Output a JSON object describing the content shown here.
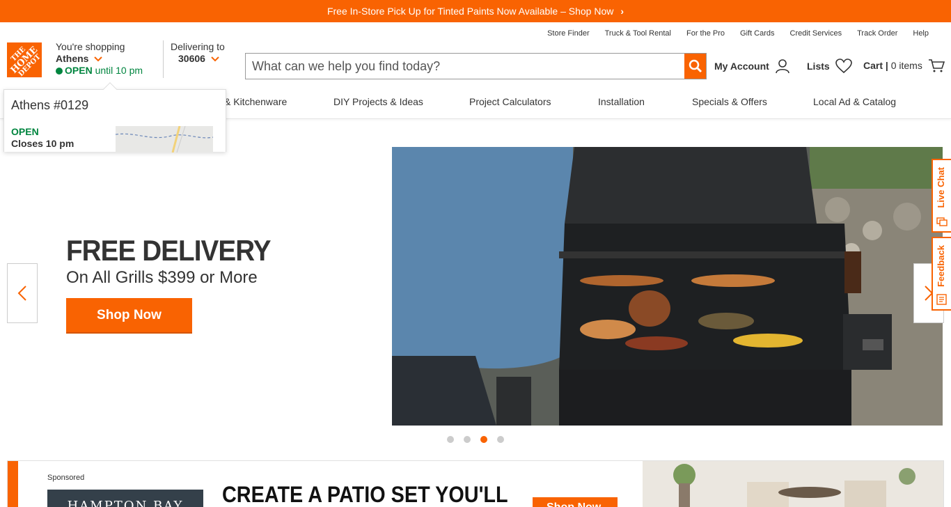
{
  "promo": {
    "text": "Free In-Store Pick Up for Tinted Paints Now Available – Shop Now",
    "chevron": "›"
  },
  "utility_links": [
    "Store Finder",
    "Truck & Tool Rental",
    "For the Pro",
    "Gift Cards",
    "Credit Services",
    "Track Order",
    "Help"
  ],
  "logo": {
    "line1": "THE",
    "line2": "HOME",
    "line3": "DEPOT"
  },
  "store": {
    "label": "You're shopping",
    "city": "Athens",
    "open_label": "OPEN",
    "hours": "until 10 pm"
  },
  "delivery": {
    "label": "Delivering to",
    "zip": "30606"
  },
  "search": {
    "placeholder": "What can we help you find today?"
  },
  "header": {
    "account": "My Account",
    "lists": "Lists",
    "cart_label": "Cart |",
    "cart_items": "0 items"
  },
  "nav": [
    "& Kitchenware",
    "DIY Projects & Ideas",
    "Project Calculators",
    "Installation",
    "Specials & Offers",
    "Local Ad & Catalog"
  ],
  "store_popover": {
    "name": "Athens #0129",
    "status": "OPEN",
    "closes": "Closes 10 pm"
  },
  "hero": {
    "title": "FREE DELIVERY",
    "subtitle": "On All Grills $399 or More",
    "button": "Shop Now",
    "active_slide": 3,
    "slide_count": 4
  },
  "side_tabs": {
    "chat": "Live Chat",
    "feedback": "Feedback"
  },
  "sponsored": {
    "tag": "Sponsored",
    "brand": "HAMPTON BAY",
    "headline": "CREATE A PATIO SET YOU'LL",
    "button": "Shop Now"
  },
  "colors": {
    "brand": "#f96302",
    "open": "#00853f"
  }
}
